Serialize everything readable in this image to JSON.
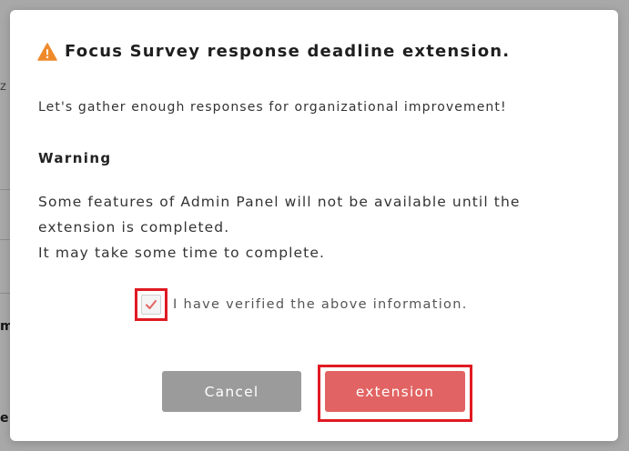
{
  "background": {
    "fragments": [
      "z",
      "m",
      "e"
    ]
  },
  "dialog": {
    "icon": "warning-triangle-icon",
    "icon_color": "#ef8a2b",
    "title": "Focus Survey response deadline extension.",
    "subtitle": "Let's gather enough responses for organizational improvement!",
    "warning_heading": "Warning",
    "warning_lines": [
      "Some features of Admin Panel will not be available until the extension is completed.",
      "It may take some time to complete."
    ],
    "verify_checkbox": {
      "checked": true,
      "label": "I have verified the above information.",
      "check_color": "#e26363"
    },
    "buttons": {
      "cancel_label": "Cancel",
      "cancel_color": "#9b9b9b",
      "extension_label": "extension",
      "extension_color": "#e26363"
    },
    "highlight_color": "#e01a22"
  }
}
